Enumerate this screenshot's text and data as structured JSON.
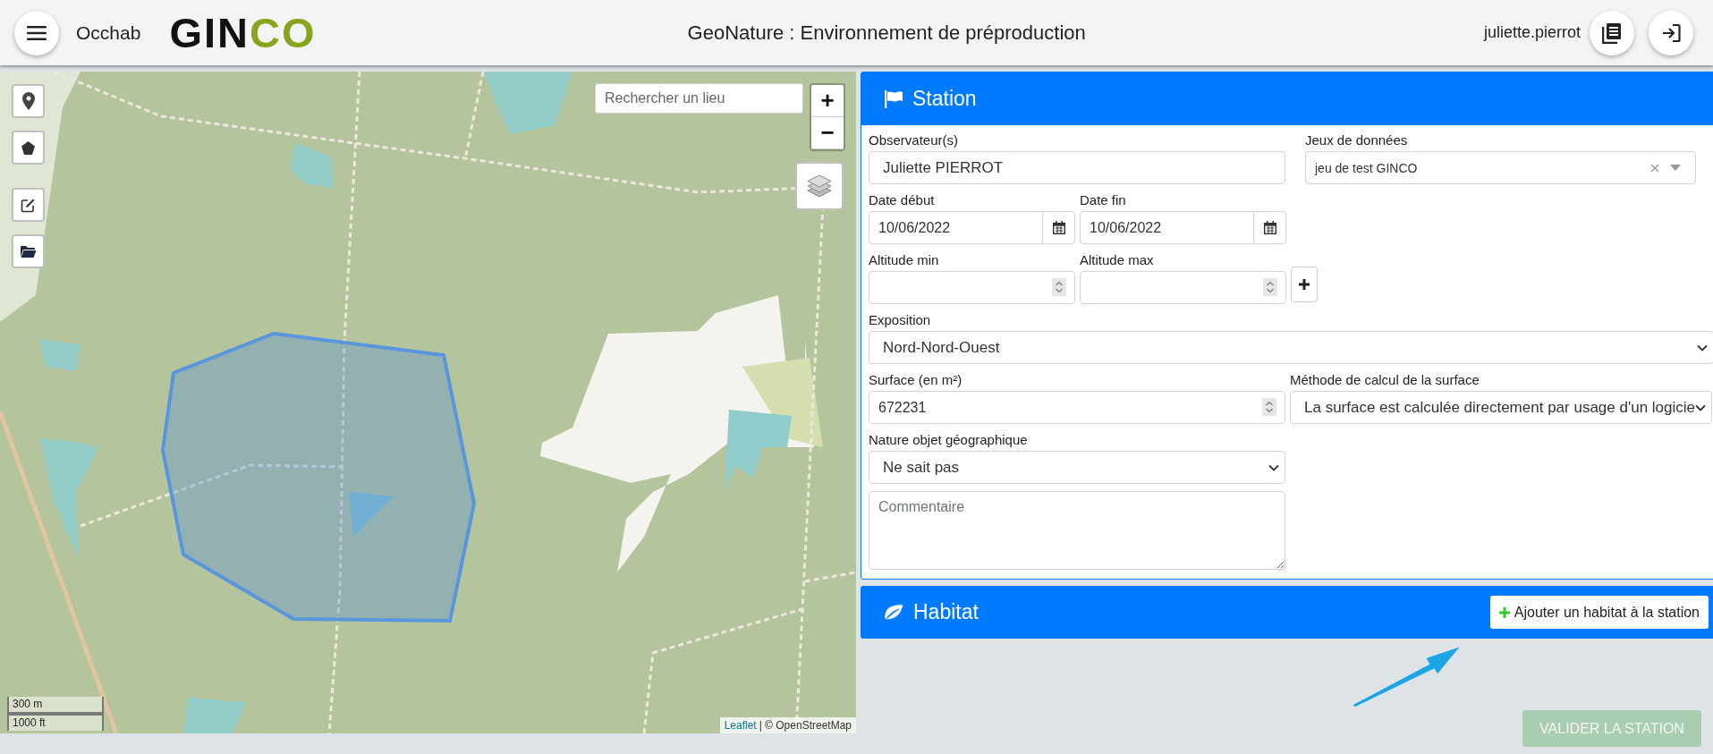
{
  "header": {
    "app_name": "Occhab",
    "logo": [
      {
        "text": "GIN",
        "color": "#111111"
      },
      {
        "text": "CO",
        "color": "#86a51c"
      }
    ],
    "title": "GeoNature : Environnement de préproduction",
    "user": "juliette.pierrot"
  },
  "map": {
    "search": {
      "placeholder": "Rechercher un lieu"
    },
    "zoom_in": "+",
    "zoom_out": "−",
    "scale": [
      "300 m",
      "1000 ft"
    ],
    "attribution": {
      "link": "Leaflet",
      "text": "| © OpenStreetMap"
    }
  },
  "station": {
    "title": "Station",
    "observers": {
      "label": "Observateur(s)",
      "value": "Juliette PIERROT"
    },
    "dataset": {
      "label": "Jeux de données",
      "value": "jeu de test GINCO"
    },
    "date_start": {
      "label": "Date début",
      "value": "10/06/2022"
    },
    "date_end": {
      "label": "Date fin",
      "value": "10/06/2022"
    },
    "altitude_min": {
      "label": "Altitude min"
    },
    "altitude_max": {
      "label": "Altitude max"
    },
    "exposition": {
      "label": "Exposition",
      "value": "Nord-Nord-Ouest"
    },
    "surface": {
      "label": "Surface (en m²)",
      "value": "672231"
    },
    "method": {
      "label": "Méthode de calcul de la surface",
      "value": "La surface est calculée directement par usage d'un logicie"
    },
    "nature": {
      "label": "Nature objet géographique",
      "value": "Ne sait pas"
    },
    "comment": {
      "placeholder": "Commentaire"
    }
  },
  "habitat": {
    "title": "Habitat",
    "add_button": "Ajouter un habitat à la station"
  },
  "validate_button": {
    "label": "VALIDER LA STATION",
    "disabled": true
  }
}
